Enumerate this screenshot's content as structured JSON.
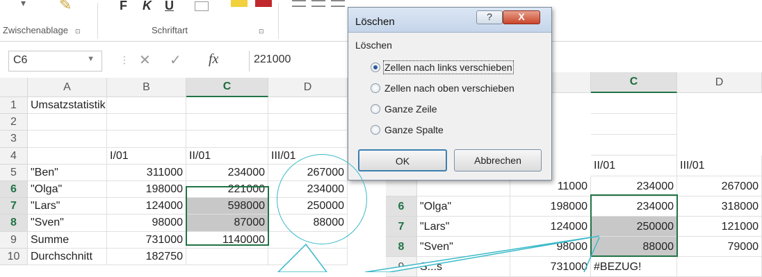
{
  "ribbon": {
    "groups": [
      "Zwischenablage",
      "Schriftart"
    ],
    "launcher_glyph": "⊡",
    "font_buttons": [
      "F",
      "K",
      "U"
    ]
  },
  "formula_bar": {
    "name_box": "C6",
    "cancel_glyph": "✕",
    "enter_glyph": "✓",
    "fx_label": "fx",
    "value": "221000"
  },
  "left_sheet": {
    "columns": [
      "A",
      "B",
      "C",
      "D"
    ],
    "rows": [
      {
        "num": "1",
        "a": "Umsatzstatistik",
        "b": "",
        "c": "",
        "d": ""
      },
      {
        "num": "2",
        "a": "",
        "b": "",
        "c": "",
        "d": ""
      },
      {
        "num": "3",
        "a": "",
        "b": "",
        "c": "",
        "d": ""
      },
      {
        "num": "4",
        "a": "",
        "b": "I/01",
        "c": "II/01",
        "d": "III/01"
      },
      {
        "num": "5",
        "a": "\"Ben\"",
        "b": "311000",
        "c": "234000",
        "d": "267000"
      },
      {
        "num": "6",
        "a": "\"Olga\"",
        "b": "198000",
        "c": "221000",
        "d": "234000"
      },
      {
        "num": "7",
        "a": "\"Lars\"",
        "b": "124000",
        "c": "598000",
        "d": "250000"
      },
      {
        "num": "8",
        "a": "\"Sven\"",
        "b": "98000",
        "c": "87000",
        "d": "88000"
      },
      {
        "num": "9",
        "a": "Summe",
        "b": "731000",
        "c": "1140000",
        "d": ""
      },
      {
        "num": "10",
        "a": "Durchschnitt",
        "b": "182750",
        "c": "",
        "d": ""
      }
    ]
  },
  "right_sheet": {
    "columns": [
      "C",
      "D"
    ],
    "header4": {
      "c": "II/01",
      "d": "III/01"
    },
    "rows": [
      {
        "num": "",
        "a": "",
        "b": "11000",
        "c": "234000",
        "d": "267000"
      },
      {
        "num": "6",
        "a": "\"Olga\"",
        "b": "198000",
        "c": "234000",
        "d": "318000"
      },
      {
        "num": "7",
        "a": "\"Lars\"",
        "b": "124000",
        "c": "250000",
        "d": "121000"
      },
      {
        "num": "8",
        "a": "\"Sven\"",
        "b": "98000",
        "c": "88000",
        "d": "79000"
      },
      {
        "num": "9",
        "a": "S...s",
        "b": "731000",
        "c": "#BEZUG!",
        "d": ""
      }
    ]
  },
  "dialog": {
    "title": "Löschen",
    "help_glyph": "?",
    "close_glyph": "X",
    "group_label": "Löschen",
    "options": [
      {
        "label": "Zellen nach links verschieben",
        "selected": true
      },
      {
        "label": "Zellen nach oben verschieben",
        "selected": false
      },
      {
        "label": "Ganze Zeile",
        "selected": false
      },
      {
        "label": "Ganze Spalte",
        "selected": false
      }
    ],
    "ok_label": "OK",
    "cancel_label": "Abbrechen"
  },
  "colors": {
    "excel_green": "#217346",
    "selection_fill": "#c8c8c8",
    "callout_line": "#39b9c8"
  }
}
